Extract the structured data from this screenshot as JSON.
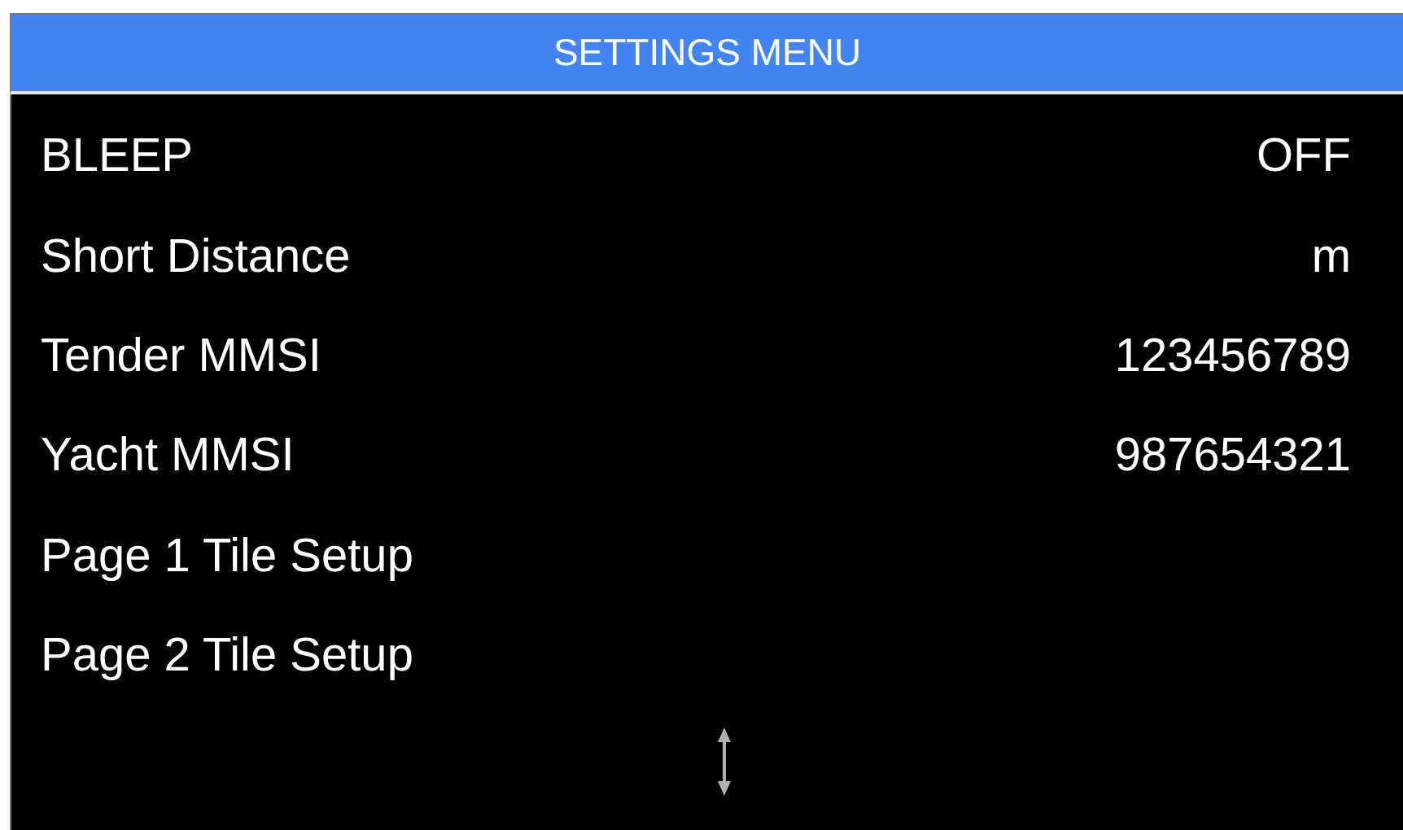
{
  "window": {
    "title": "SETTINGS MENU"
  },
  "settings": [
    {
      "label": "BLEEP",
      "value": "OFF"
    },
    {
      "label": "Short Distance",
      "value": "m"
    },
    {
      "label": "Tender MMSI",
      "value": "123456789"
    },
    {
      "label": "Yacht MMSI",
      "value": "987654321"
    },
    {
      "label": "Page 1 Tile Setup"
    },
    {
      "label": "Page 2 Tile Setup"
    }
  ]
}
